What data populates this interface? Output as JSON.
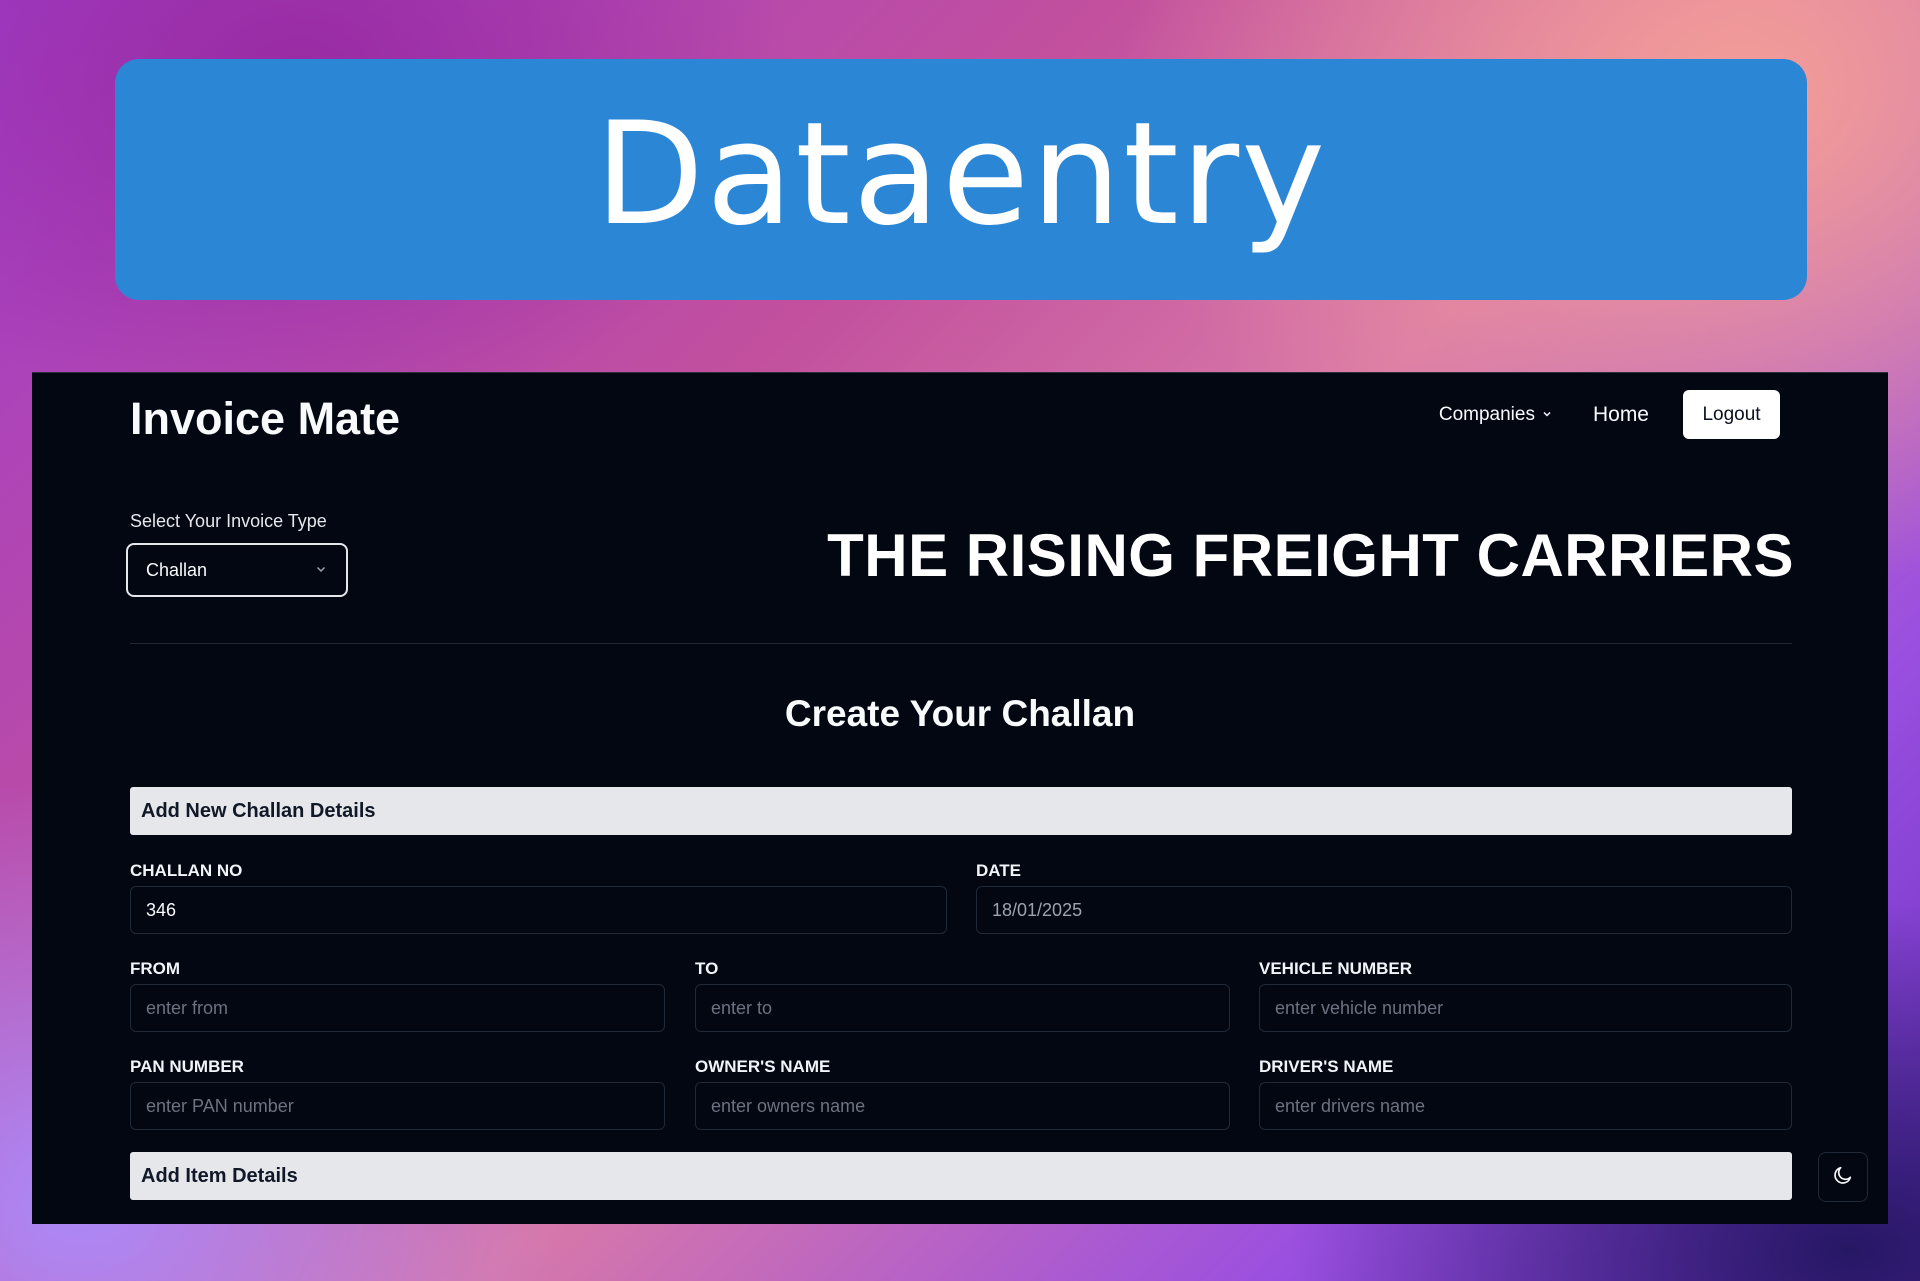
{
  "banner": {
    "title": "Dataentry"
  },
  "nav": {
    "logo": "Invoice Mate",
    "companies_label": "Companies",
    "home_label": "Home",
    "logout_label": "Logout"
  },
  "invoice_type": {
    "label": "Select Your Invoice Type",
    "selected": "Challan"
  },
  "company_name": "THE RISING FREIGHT CARRIERS",
  "form": {
    "heading": "Create Your Challan",
    "section_challan": "Add New Challan Details",
    "section_items": "Add Item Details",
    "fields": {
      "challan_no": {
        "label": "CHALLAN NO",
        "value": "346"
      },
      "date": {
        "label": "DATE",
        "value": "18/01/2025"
      },
      "from": {
        "label": "FROM",
        "placeholder": "enter from"
      },
      "to": {
        "label": "TO",
        "placeholder": "enter to"
      },
      "vehicle_number": {
        "label": "VEHICLE NUMBER",
        "placeholder": "enter vehicle number"
      },
      "pan_number": {
        "label": "PAN NUMBER",
        "placeholder": "enter PAN number"
      },
      "owners_name": {
        "label": "OWNER'S NAME",
        "placeholder": "enter owners name"
      },
      "drivers_name": {
        "label": "DRIVER'S NAME",
        "placeholder": "enter drivers name"
      }
    }
  },
  "icons": {
    "theme_toggle": "moon-icon",
    "dropdown": "chevron-down-icon"
  },
  "colors": {
    "banner": "#2b86d6",
    "app_bg": "#030712",
    "section_bar": "#e5e7eb"
  }
}
